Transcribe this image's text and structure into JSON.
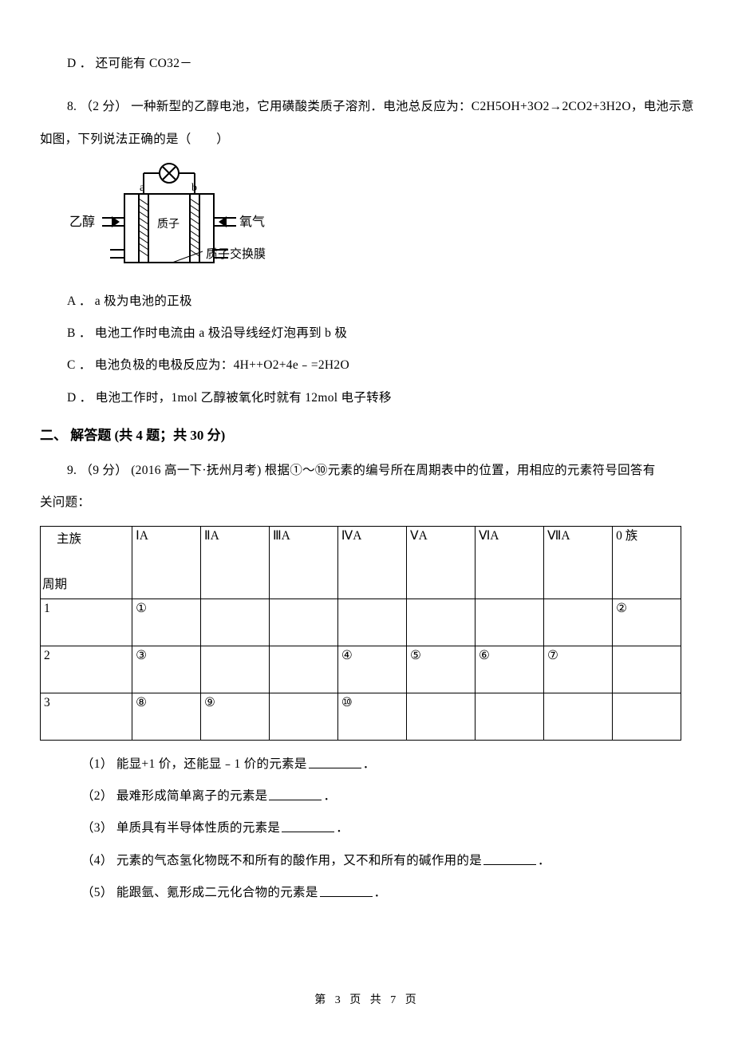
{
  "q7": {
    "option_d": "D ． 还可能有 CO32－"
  },
  "q8": {
    "stem_line1": "8. （2 分） 一种新型的乙醇电池，它用磺酸类质子溶剂．电池总反应为：C2H5OH+3O2→2CO2+3H2O，电池示意",
    "stem_line2": "如图，下列说法正确的是（　　）",
    "diagram": {
      "label_ethanol": "乙醇",
      "label_oxygen": "氧气",
      "label_proton": "质子",
      "label_membrane": "质子交换膜",
      "terminal_a": "a",
      "terminal_b": "b"
    },
    "option_a": "A ． a 极为电池的正极",
    "option_b": "B ． 电池工作时电流由 a 极沿导线经灯泡再到 b 极",
    "option_c": "C ． 电池负极的电极反应为：4H++O2+4e﹣=2H2O",
    "option_d": "D ． 电池工作时，1mol 乙醇被氧化时就有 12mol 电子转移"
  },
  "section2": {
    "title": "二、 解答题 (共 4 题；共 30 分)"
  },
  "q9": {
    "stem_line1": "9. （9 分） (2016 高一下·抚州月考) 根据①～⑩元素的编号所在周期表中的位置，用相应的元素符号回答有",
    "stem_line2": "关问题：",
    "table": {
      "header_top": "主族",
      "header_bottom": "周期",
      "groups": [
        "ⅠA",
        "ⅡA",
        "ⅢA",
        "ⅣA",
        "ⅤA",
        "ⅥA",
        "ⅦA",
        "0 族"
      ],
      "periods": [
        "1",
        "2",
        "3"
      ],
      "cells": {
        "r1c1": "①",
        "r1c8": "②",
        "r2c1": "③",
        "r2c4": "④",
        "r2c5": "⑤",
        "r2c6": "⑥",
        "r2c7": "⑦",
        "r3c1": "⑧",
        "r3c2": "⑨",
        "r3c4": "⑩"
      }
    },
    "sub1": "（1） 能显+1 价，还能显﹣1 价的元素是",
    "sub2": "（2） 最难形成简单离子的元素是",
    "sub3": "（3） 单质具有半导体性质的元素是",
    "sub4": "（4） 元素的气态氢化物既不和所有的酸作用，又不和所有的碱作用的是",
    "sub5": "（5） 能跟氩、氪形成二元化合物的元素是",
    "period": "．"
  },
  "footer": "第 3 页 共 7 页"
}
